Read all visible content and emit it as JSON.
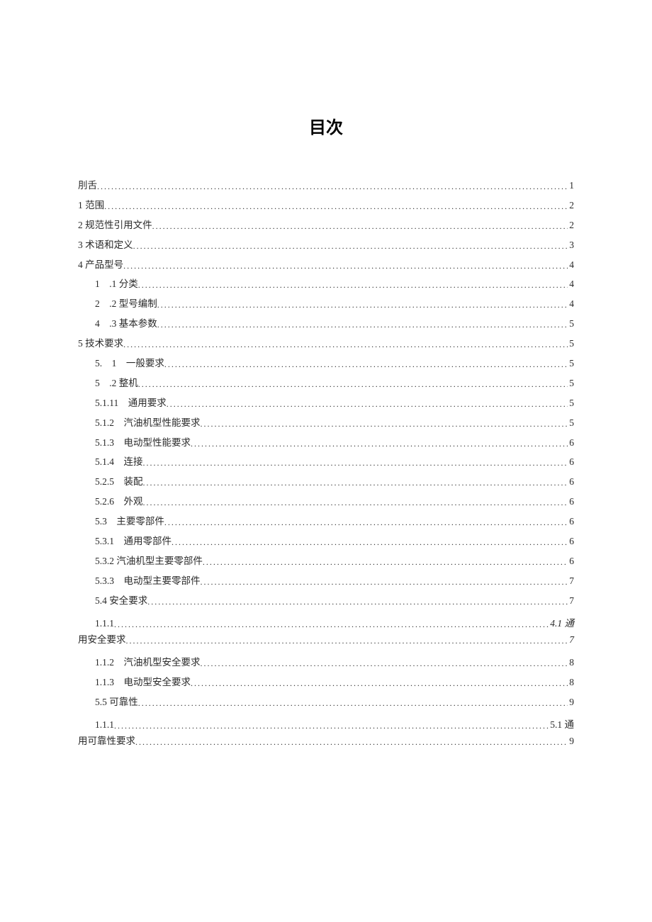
{
  "title": "目次",
  "entries": [
    {
      "id": "e0",
      "indent": 0,
      "label": "刖舌",
      "page": "1",
      "italic": false
    },
    {
      "id": "e1",
      "indent": 0,
      "label": "1 范围",
      "page": "2",
      "italic": false
    },
    {
      "id": "e2",
      "indent": 0,
      "label": "2 规范性引用文件",
      "page": "2",
      "italic": false
    },
    {
      "id": "e3",
      "indent": 0,
      "label": "3 术语和定义",
      "page": "3",
      "italic": false
    },
    {
      "id": "e4",
      "indent": 0,
      "label": "4 产品型号",
      "page": "4",
      "italic": false
    },
    {
      "id": "e5",
      "indent": 1,
      "label": "1　.1 分类",
      "page": "4",
      "italic": false
    },
    {
      "id": "e6",
      "indent": 1,
      "label": "2　.2 型号编制",
      "page": "4",
      "italic": false
    },
    {
      "id": "e7",
      "indent": 1,
      "label": "4　.3 基本参数",
      "page": "5",
      "italic": false
    },
    {
      "id": "e8",
      "indent": 0,
      "label": "5 技术要求",
      "page": "5",
      "italic": false
    },
    {
      "id": "e9",
      "indent": 1,
      "label": "5.　1　一般要求",
      "page": "5",
      "italic": false
    },
    {
      "id": "e10",
      "indent": 1,
      "label": "5　.2 整机",
      "page": "5",
      "italic": false
    },
    {
      "id": "e11",
      "indent": 2,
      "label": "5.1.11　通用要求",
      "page": "5",
      "italic": false
    },
    {
      "id": "e12",
      "indent": 2,
      "label": "5.1.2　汽油机型性能要求",
      "page": "5",
      "italic": false
    },
    {
      "id": "e13",
      "indent": 2,
      "label": "5.1.3　电动型性能要求",
      "page": "6",
      "italic": false
    },
    {
      "id": "e14",
      "indent": 2,
      "label": "5.1.4　连接",
      "page": "6",
      "italic": false
    },
    {
      "id": "e15",
      "indent": 2,
      "label": "5.2.5　装配",
      "page": "6",
      "italic": false
    },
    {
      "id": "e16",
      "indent": 2,
      "label": "5.2.6　外观",
      "page": "6",
      "italic": false
    },
    {
      "id": "e17",
      "indent": 1,
      "label": "5.3　主要零部件",
      "page": "6",
      "italic": false
    },
    {
      "id": "e18",
      "indent": 2,
      "label": "5.3.1　通用零部件",
      "page": "6",
      "italic": false
    },
    {
      "id": "e19",
      "indent": 2,
      "label": "5.3.2 汽油机型主要零部件",
      "page": "6",
      "italic": false
    },
    {
      "id": "e20",
      "indent": 2,
      "label": "5.3.3　电动型主要零部件",
      "page": "7",
      "italic": false
    },
    {
      "id": "e21",
      "indent": 1,
      "label": "5.4 安全要求",
      "page": "7",
      "italic": false
    },
    {
      "id": "e22",
      "indent": 2,
      "type": "wrap",
      "label1": "1.1.1",
      "page1": "4.1 通",
      "label2": "用安全要求",
      "page2": "7",
      "italic": true
    },
    {
      "id": "e23",
      "indent": 2,
      "label": "1.1.2　汽油机型安全要求",
      "page": "8",
      "italic": false
    },
    {
      "id": "e24",
      "indent": 2,
      "label": "1.1.3　电动型安全要求",
      "page": "8",
      "italic": false
    },
    {
      "id": "e25",
      "indent": 1,
      "label": "5.5 可靠性",
      "page": "9",
      "italic": false
    },
    {
      "id": "e26",
      "indent": 2,
      "type": "wrap",
      "label1": "1.1.1",
      "page1": "5.1 通",
      "label2": "用可靠性要求",
      "page2": "9",
      "italic": false
    }
  ]
}
